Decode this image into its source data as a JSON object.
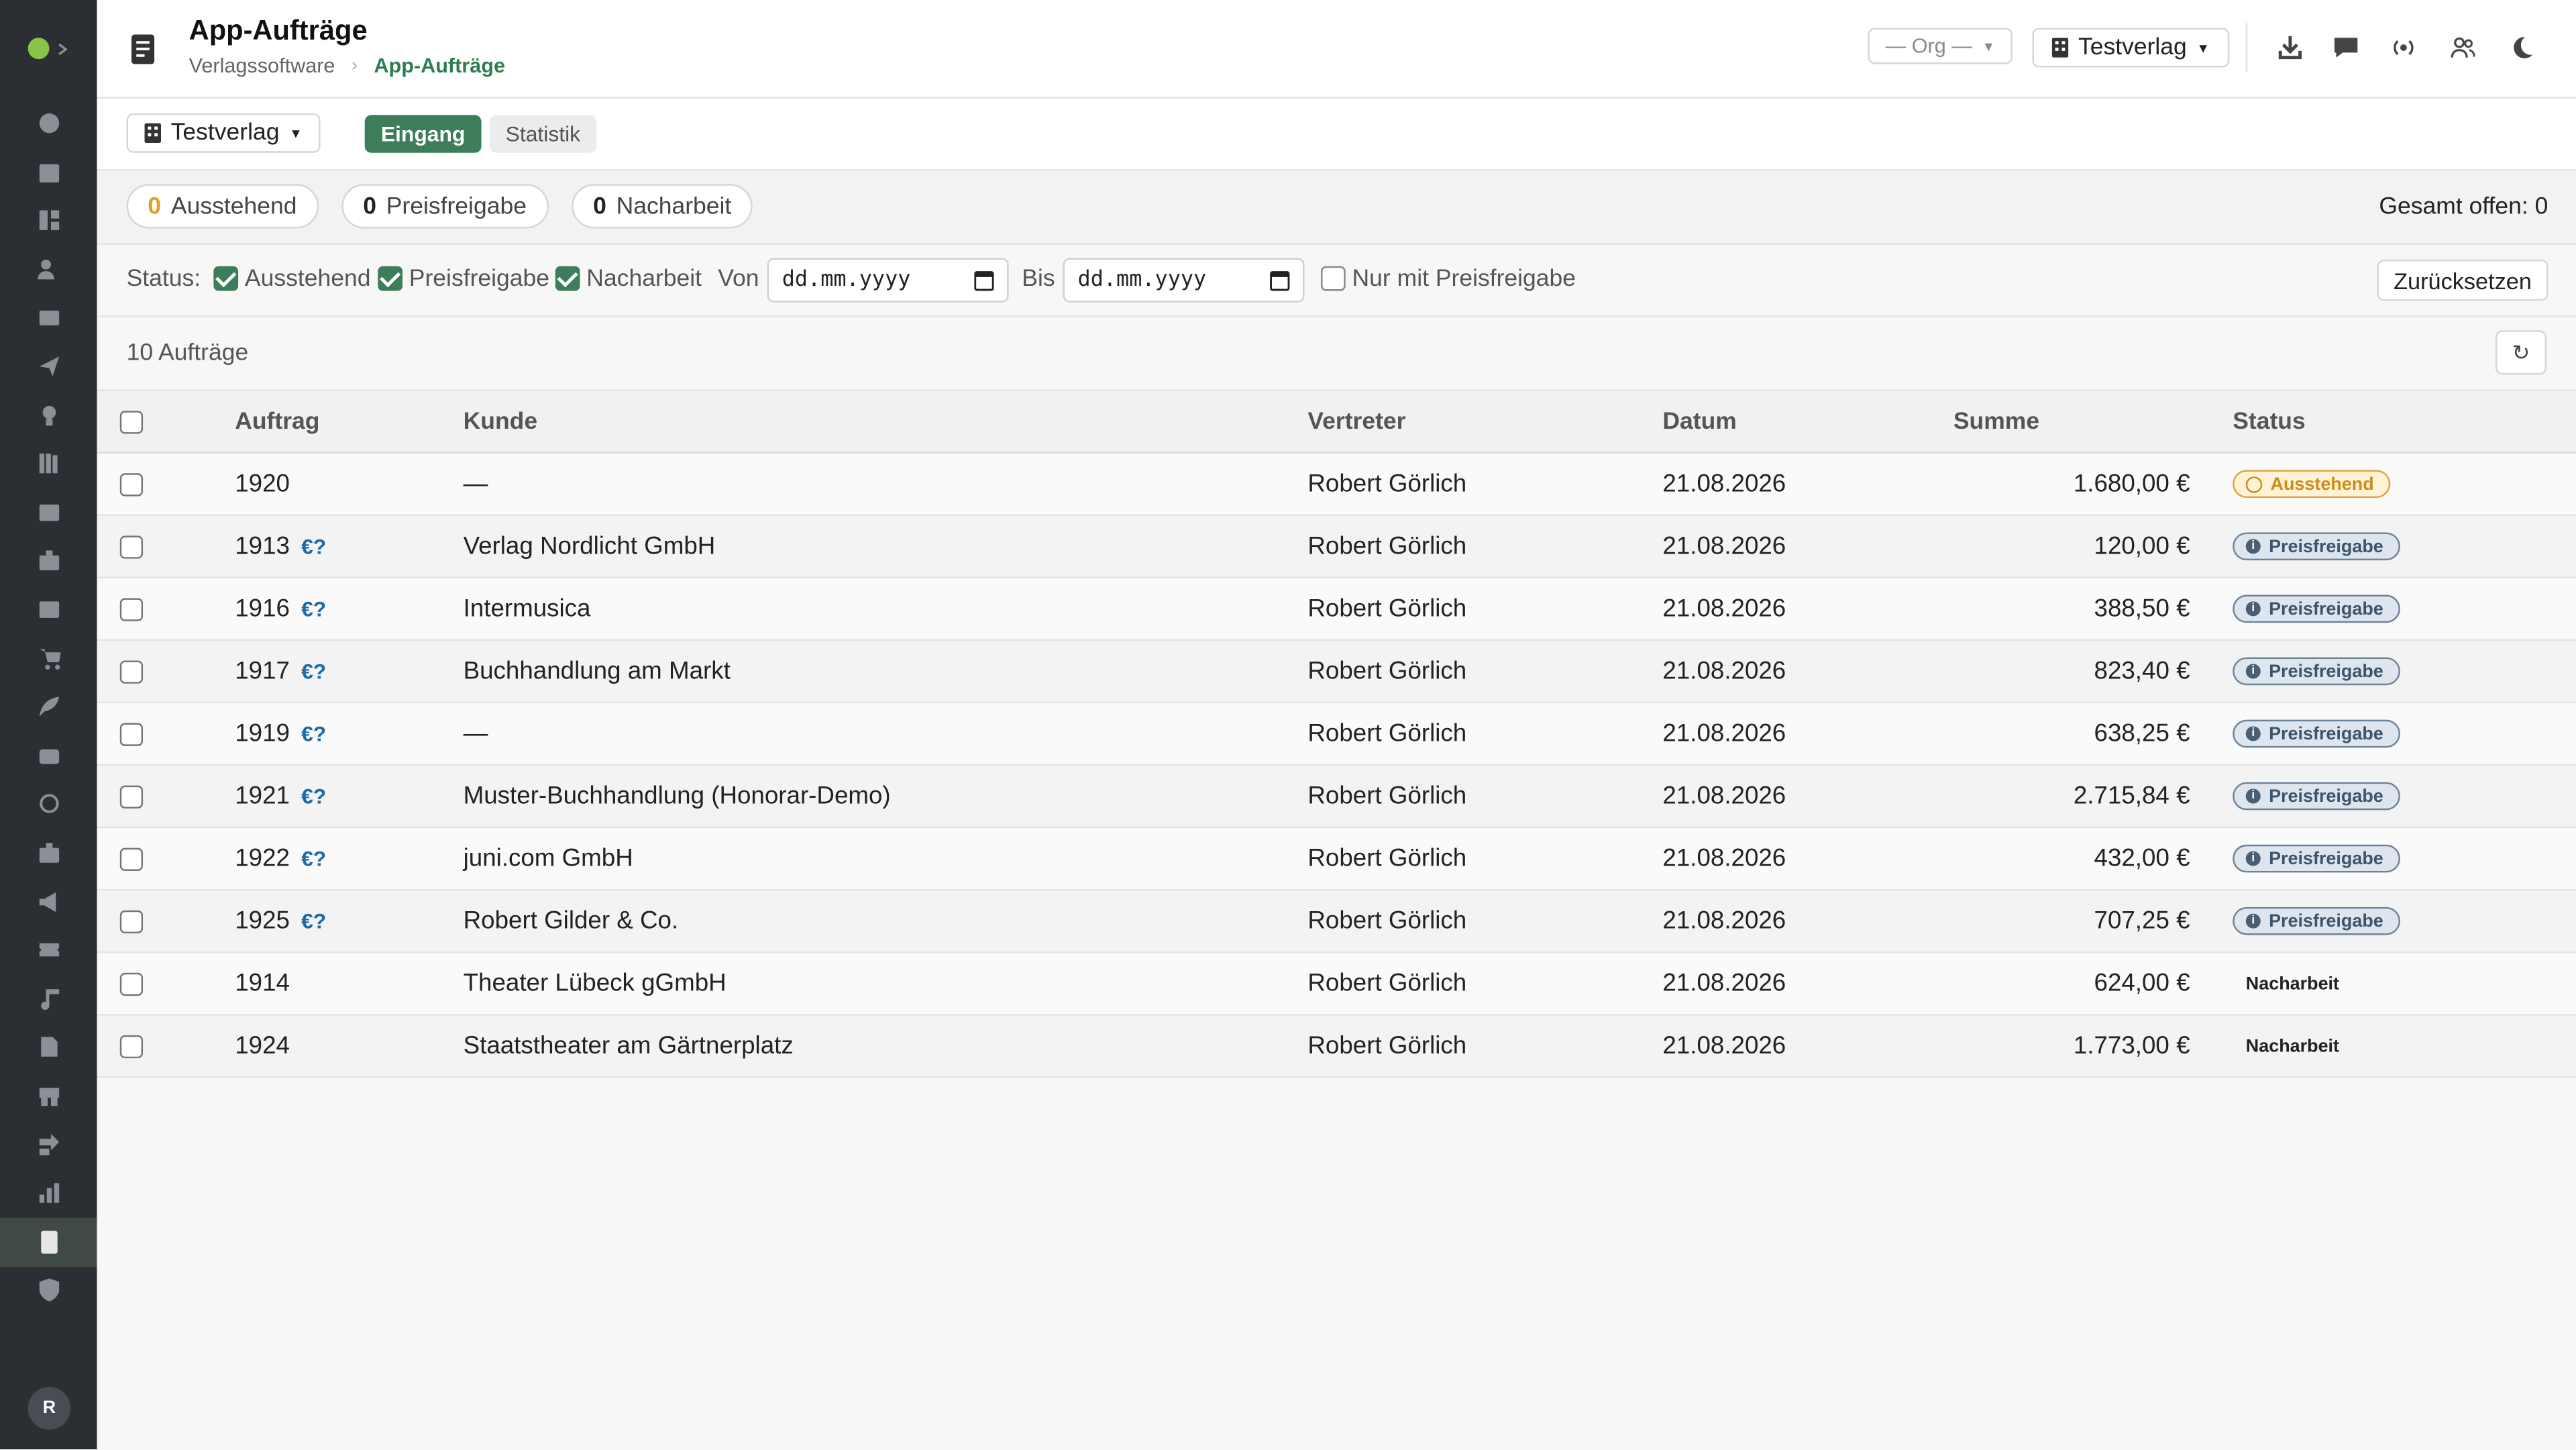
{
  "header": {
    "title": "App-Aufträge",
    "breadcrumb": {
      "parent": "Verlagssoftware",
      "separator": "›",
      "current": "App-Aufträge"
    },
    "org_select": "— Org —",
    "tenant_select": "Testverlag",
    "icons": [
      "download-icon",
      "chat-icon",
      "broadcast-icon",
      "users-icon",
      "moon-icon"
    ]
  },
  "toolbar": {
    "tenant": "Testverlag",
    "tabs": [
      {
        "label": "Eingang",
        "active": true
      },
      {
        "label": "Statistik",
        "active": false
      }
    ]
  },
  "summary": {
    "ausstehend": {
      "count": "0",
      "label": "Ausstehend"
    },
    "preisfreigabe": {
      "count": "0",
      "label": "Preisfreigabe"
    },
    "nacharbeit": {
      "count": "0",
      "label": "Nacharbeit"
    },
    "total": "Gesamt offen: 0"
  },
  "filters": {
    "status_label": "Status:",
    "ausstehend": {
      "label": "Ausstehend",
      "checked": true
    },
    "preisfreigabe": {
      "label": "Preisfreigabe",
      "checked": true
    },
    "nacharbeit": {
      "label": "Nacharbeit",
      "checked": true
    },
    "von_label": "Von",
    "von_value": "dd.mm.yyyy",
    "bis_label": "Bis",
    "bis_value": "dd.mm.yyyy",
    "nur_preisfreigabe": {
      "label": "Nur mit Preisfreigabe",
      "checked": false
    },
    "reset_label": "Zurücksetzen"
  },
  "list": {
    "count": "10 Aufträge",
    "refresh_icon": "↻"
  },
  "table": {
    "columns": [
      "Auftrag",
      "Kunde",
      "Vertreter",
      "Datum",
      "Summe",
      "Status"
    ],
    "rows": [
      {
        "auftrag": "1920",
        "flag": "",
        "kunde": "—",
        "vertreter": "Robert Görlich",
        "datum": "21.08.2026",
        "summe": "1.680,00 €",
        "status": "Ausstehend"
      },
      {
        "auftrag": "1913",
        "flag": "€?",
        "kunde": "Verlag Nordlicht GmbH",
        "vertreter": "Robert Görlich",
        "datum": "21.08.2026",
        "summe": "120,00 €",
        "status": "Preisfreigabe"
      },
      {
        "auftrag": "1916",
        "flag": "€?",
        "kunde": "Intermusica",
        "vertreter": "Robert Görlich",
        "datum": "21.08.2026",
        "summe": "388,50 €",
        "status": "Preisfreigabe"
      },
      {
        "auftrag": "1917",
        "flag": "€?",
        "kunde": "Buchhandlung am Markt",
        "vertreter": "Robert Görlich",
        "datum": "21.08.2026",
        "summe": "823,40 €",
        "status": "Preisfreigabe"
      },
      {
        "auftrag": "1919",
        "flag": "€?",
        "kunde": "—",
        "vertreter": "Robert Görlich",
        "datum": "21.08.2026",
        "summe": "638,25 €",
        "status": "Preisfreigabe"
      },
      {
        "auftrag": "1921",
        "flag": "€?",
        "kunde": "Muster-Buchhandlung (Honorar-Demo)",
        "vertreter": "Robert Görlich",
        "datum": "21.08.2026",
        "summe": "2.715,84 €",
        "status": "Preisfreigabe"
      },
      {
        "auftrag": "1922",
        "flag": "€?",
        "kunde": "juni.com GmbH",
        "vertreter": "Robert Görlich",
        "datum": "21.08.2026",
        "summe": "432,00 €",
        "status": "Preisfreigabe"
      },
      {
        "auftrag": "1925",
        "flag": "€?",
        "kunde": "Robert Gilder & Co.",
        "vertreter": "Robert Görlich",
        "datum": "21.08.2026",
        "summe": "707,25 €",
        "status": "Preisfreigabe"
      },
      {
        "auftrag": "1914",
        "flag": "",
        "kunde": "Theater Lübeck gGmbH",
        "vertreter": "Robert Görlich",
        "datum": "21.08.2026",
        "summe": "624,00 €",
        "status": "Nacharbeit"
      },
      {
        "auftrag": "1924",
        "flag": "",
        "kunde": "Staatstheater am Gärtnerplatz",
        "vertreter": "Robert Görlich",
        "datum": "21.08.2026",
        "summe": "1.773,00 €",
        "status": "Nacharbeit"
      }
    ]
  },
  "sidebar": {
    "avatar": "R",
    "icons": [
      "dashboard-icon",
      "calendar-icon",
      "grid-icon",
      "edit-user-icon",
      "mail-stack-icon",
      "send-icon",
      "lightbulb-icon",
      "library-icon",
      "image-icon",
      "briefcase-icon",
      "card-icon",
      "cart-icon",
      "feather-icon",
      "wallet-icon",
      "circle-icon",
      "suitcase-icon",
      "megaphone-icon",
      "ticket-icon",
      "music-icon",
      "document-icon",
      "store-icon",
      "forward-icon",
      "bar-chart-icon",
      "orders-icon",
      "shield-icon"
    ],
    "active": "orders-icon"
  },
  "colors": {
    "accent": "#3e7d5a",
    "sidebar_bg": "#2b2f33",
    "link": "#1f6aa5",
    "warn": "#e6a23c"
  }
}
